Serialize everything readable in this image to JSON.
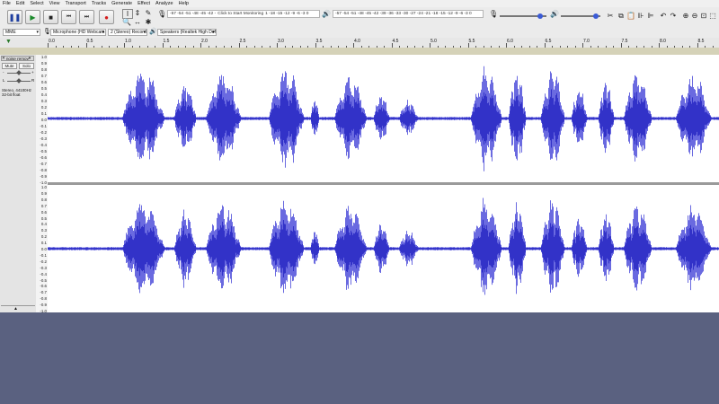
{
  "menu": [
    "File",
    "Edit",
    "Select",
    "View",
    "Transport",
    "Tracks",
    "Generate",
    "Effect",
    "Analyze",
    "Help"
  ],
  "transport": {
    "pause": "pause-icon",
    "play": "play-icon",
    "stop": "stop-icon",
    "skip_start": "skip-start-icon",
    "skip_end": "skip-end-icon",
    "record": "record-icon"
  },
  "meters": {
    "record_scale": "-57 -54 -51 -48 -45 -42 -",
    "record_hint": "Click to Start Monitoring",
    "record_scale2": "1 -18 -15 -12 -9 -6 -3 0",
    "play_scale": "-57 -54 -51 -48 -45 -42 -39 -36 -33 -30 -27 -24 -21 -18 -15 -12 -9 -6 -3 0"
  },
  "devices": {
    "host": "MME",
    "mic": "Microphone (HD Webcam",
    "channels": "2 (Stereo) Record",
    "speakers": "Speakers (Realtek High Def"
  },
  "ruler": {
    "ticks": [
      "0.0",
      "0.5",
      "1.0",
      "1.5",
      "2.0",
      "2.5",
      "3.0",
      "3.5",
      "4.0",
      "4.5",
      "5.0",
      "5.5",
      "6.0",
      "6.5",
      "7.0",
      "7.5",
      "8.0",
      "8.5"
    ]
  },
  "track": {
    "name": "noise remov",
    "mute": "Mute",
    "solo": "Solo",
    "info1": "Stereo, 44100Hz",
    "info2": "32-bit float",
    "lr_left": "L",
    "lr_right": "R",
    "minus": "-",
    "plus": "+"
  },
  "vscale_top": [
    "1.0",
    "0.9",
    "0.8",
    "0.7",
    "0.6",
    "0.5",
    "0.4",
    "0.3",
    "0.2",
    "0.1",
    "0.0",
    "-0.1",
    "-0.2",
    "-0.3",
    "-0.4",
    "-0.5",
    "-0.6",
    "-0.7",
    "-0.8",
    "-0.9",
    "-1.0"
  ],
  "colors": {
    "wave_dark": "#3232c8",
    "wave_light": "#6a6ae0",
    "wave_bg": "#ffffff",
    "empty_bg": "#5a6180"
  }
}
